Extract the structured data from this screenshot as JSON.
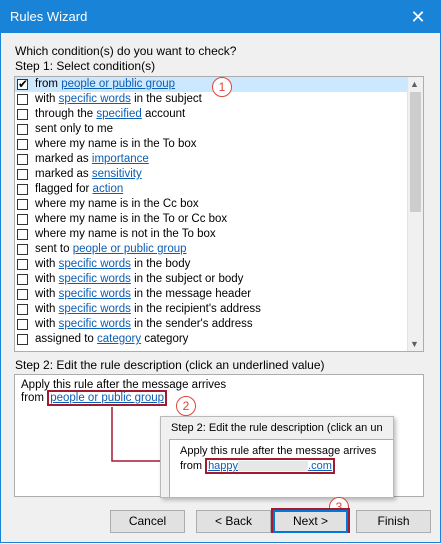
{
  "window": {
    "title": "Rules Wizard",
    "close_glyph": "✕"
  },
  "prompt": "Which condition(s) do you want to check?",
  "step1_label": "Step 1: Select condition(s)",
  "conditions": [
    {
      "pre": "from ",
      "link": "people or public group",
      "post": "",
      "checked": true
    },
    {
      "pre": "with ",
      "link": "specific words",
      "post": " in the subject",
      "checked": false
    },
    {
      "pre": "through the ",
      "link": "specified",
      "post": " account",
      "checked": false
    },
    {
      "pre": "sent only to me",
      "link": "",
      "post": "",
      "checked": false
    },
    {
      "pre": "where my name is in the To box",
      "link": "",
      "post": "",
      "checked": false
    },
    {
      "pre": "marked as ",
      "link": "importance",
      "post": "",
      "checked": false
    },
    {
      "pre": "marked as ",
      "link": "sensitivity",
      "post": "",
      "checked": false
    },
    {
      "pre": "flagged for ",
      "link": "action",
      "post": "",
      "checked": false
    },
    {
      "pre": "where my name is in the Cc box",
      "link": "",
      "post": "",
      "checked": false
    },
    {
      "pre": "where my name is in the To or Cc box",
      "link": "",
      "post": "",
      "checked": false
    },
    {
      "pre": "where my name is not in the To box",
      "link": "",
      "post": "",
      "checked": false
    },
    {
      "pre": "sent to ",
      "link": "people or public group",
      "post": "",
      "checked": false
    },
    {
      "pre": "with ",
      "link": "specific words",
      "post": " in the body",
      "checked": false
    },
    {
      "pre": "with ",
      "link": "specific words",
      "post": " in the subject or body",
      "checked": false
    },
    {
      "pre": "with ",
      "link": "specific words",
      "post": " in the message header",
      "checked": false
    },
    {
      "pre": "with ",
      "link": "specific words",
      "post": " in the recipient's address",
      "checked": false
    },
    {
      "pre": "with ",
      "link": "specific words",
      "post": " in the sender's address",
      "checked": false
    },
    {
      "pre": "assigned to ",
      "link": "category",
      "post": " category",
      "checked": false
    }
  ],
  "step2_label": "Step 2: Edit the rule description (click an underlined value)",
  "description": {
    "line1": "Apply this rule after the message arrives",
    "from_pre": "from ",
    "from_link": "people or public group"
  },
  "inset": {
    "label": "Step 2: Edit the rule description (click an un",
    "line1": "Apply this rule after the message arrives",
    "from_pre": "from ",
    "link_start": "happy",
    "link_end": ".com"
  },
  "badges": {
    "one": "1",
    "two": "2",
    "three": "3"
  },
  "buttons": {
    "cancel": "Cancel",
    "back": "< Back",
    "next": "Next >",
    "finish": "Finish"
  },
  "colors": {
    "titlebar": "#1883d7",
    "link": "#0b5db5",
    "highlight": "#a31b31",
    "badge": "#e0453a"
  }
}
